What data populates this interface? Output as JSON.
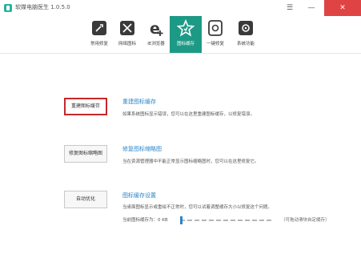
{
  "window": {
    "title": "软媒电脑医生 1.0.5.0",
    "controls": [
      "☰",
      "—",
      "✕"
    ]
  },
  "toolbar": {
    "items": [
      {
        "label": "常用修复",
        "icon": "repair-wrench-icon"
      },
      {
        "label": "网络图标",
        "icon": "network-tools-icon"
      },
      {
        "label": "IE浏览器",
        "icon": "ie-browser-icon"
      },
      {
        "label": "图标缓存",
        "icon": "star-cache-icon",
        "active": true
      },
      {
        "label": "一键修复",
        "icon": "one-click-repair-icon"
      },
      {
        "label": "系统功能",
        "icon": "system-functions-icon"
      }
    ],
    "accent_color": "#1d9a86"
  },
  "sections": [
    {
      "button": "重建图标缓存",
      "title": "重建图标缓存",
      "desc": "如果系统图标显示错误，您可以在这里重建图标缓存，以修复错误。"
    },
    {
      "button": "修复图标缩略图",
      "title": "修复图标缩略图",
      "desc": "当在资源管理器中不能正常显示图标缩略图时，您可以在这里修复它。"
    },
    {
      "button": "自动优化",
      "title": "图标缓存设置",
      "desc": "当桌面图标显示或重绘不正常时，您可以试着调整缓存大小以修复这个问题。"
    }
  ],
  "cache_setting": {
    "label": "当前图标缓存为：0 KB",
    "hint": "（可拖动滑块自定缓存）",
    "slider_level": 0
  },
  "colors": {
    "link_blue": "#2a86c9",
    "selected_border": "#c62828",
    "close_red": "#e04343"
  }
}
